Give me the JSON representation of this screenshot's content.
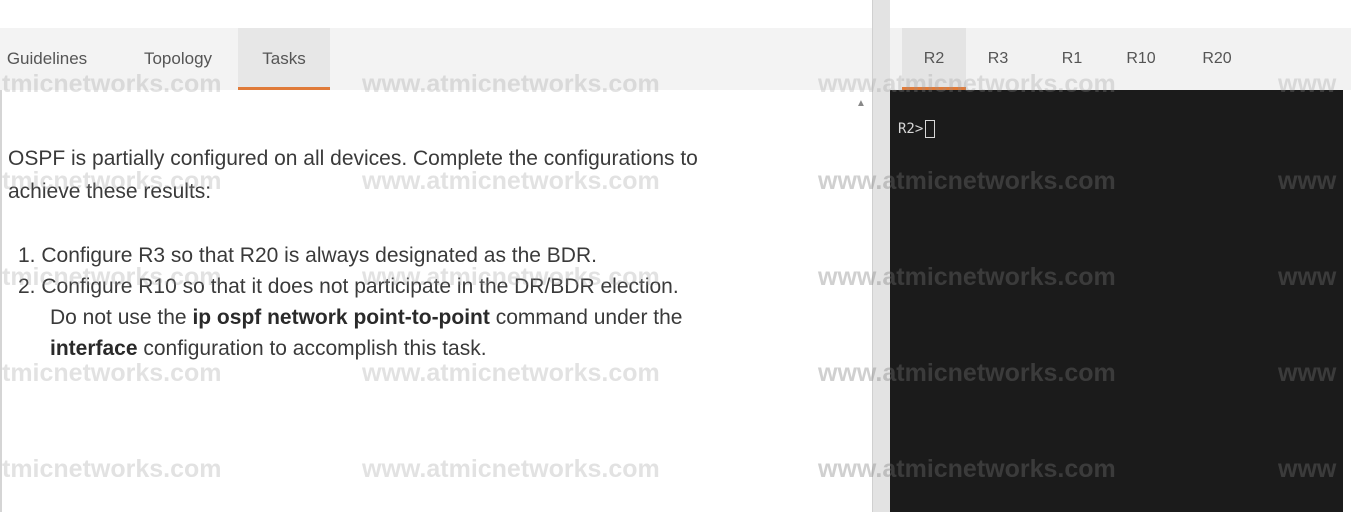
{
  "left_tabs": [
    {
      "label": "Guidelines",
      "active": false
    },
    {
      "label": "Topology",
      "active": false
    },
    {
      "label": "Tasks",
      "active": true
    }
  ],
  "intro": "OSPF is partially configured on all devices. Complete the configurations to achieve these results:",
  "intro_lines": [
    "OSPF is partially configured on all devices. Complete the configurations to",
    "achieve these results:"
  ],
  "tasks": {
    "t1": "1. Configure R3 so that R20 is always designated as the BDR.",
    "t2": "2. Configure R10 so that it does not participate in the DR/BDR election.",
    "t2_line2_a": "Do not use the ",
    "t2_line2_bold": "ip ospf network point-to-point",
    "t2_line2_b": " command under the",
    "t2_line3_bold": "interface",
    "t2_line3_b": " configuration to accomplish this task."
  },
  "right_tabs": [
    {
      "label": "R2",
      "active": true
    },
    {
      "label": "R3",
      "active": false
    },
    {
      "label": "R1",
      "active": false
    },
    {
      "label": "R10",
      "active": false
    },
    {
      "label": "R20",
      "active": false
    }
  ],
  "terminal": {
    "prompt": "R2>"
  },
  "watermark": {
    "full": "www.atmicnetworks.com",
    "left_partial": "tmicnetworks.com",
    "right_partial": "www"
  },
  "colors": {
    "accent": "#e07b39",
    "terminal_bg": "#1b1b1b"
  }
}
